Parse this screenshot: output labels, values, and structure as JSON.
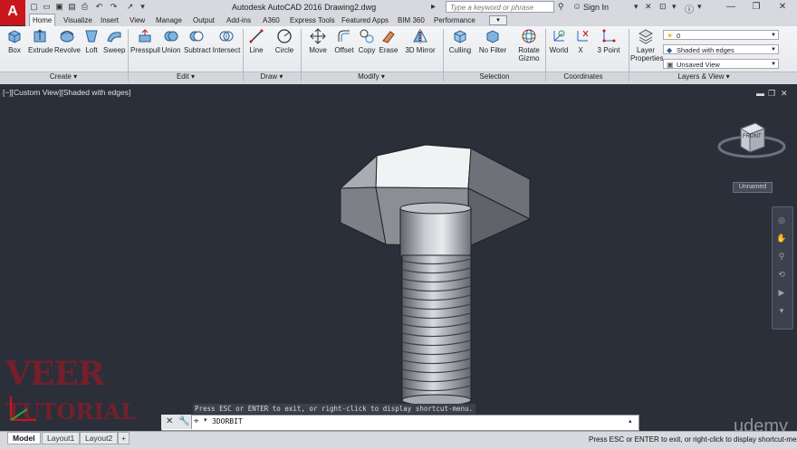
{
  "window": {
    "title": "Autodesk AutoCAD 2016   Drawing2.dwg",
    "search_placeholder": "Type a keyword or phrase",
    "signin_label": "Sign In",
    "app_logo": "A"
  },
  "tabs": [
    {
      "label": "Home",
      "active": true
    },
    {
      "label": "Visualize"
    },
    {
      "label": "Insert"
    },
    {
      "label": "View"
    },
    {
      "label": "Manage"
    },
    {
      "label": "Output"
    },
    {
      "label": "Add-ins"
    },
    {
      "label": "A360"
    },
    {
      "label": "Express Tools"
    },
    {
      "label": "Featured Apps"
    },
    {
      "label": "BIM 360"
    },
    {
      "label": "Performance"
    }
  ],
  "ribbon": {
    "create": {
      "label": "Create",
      "tools": [
        "Box",
        "Extrude",
        "Revolve",
        "Loft",
        "Sweep"
      ]
    },
    "edit": {
      "label": "Edit",
      "tools": [
        "Presspull",
        "Union",
        "Subtract",
        "Intersect"
      ]
    },
    "draw": {
      "label": "Draw",
      "tools": [
        "Line",
        "Circle"
      ]
    },
    "modify": {
      "label": "Modify",
      "tools": [
        "Move",
        "Offset",
        "Copy",
        "Erase",
        "3D Mirror"
      ]
    },
    "selection": {
      "label": "Selection",
      "tools": [
        "Culling",
        "No Filter",
        "Rotate Gizmo"
      ]
    },
    "coordinates": {
      "label": "Coordinates",
      "tools": [
        "World",
        "X",
        "3 Point"
      ]
    },
    "layers": {
      "label": "Layers & View",
      "tool": "Layer Properties",
      "layer_value": "0",
      "visual_style": "Shaded with edges",
      "view": "Unsaved View"
    }
  },
  "viewport": {
    "label": "[−][Custom View][Shaded with edges]",
    "viewcube_face": "FRONT",
    "ucs_name": "Unnamed"
  },
  "command": {
    "history": "Press ESC or ENTER to exit, or right-click to display shortcut-menu.",
    "input": "3DORBIT"
  },
  "layout_tabs": [
    "Model",
    "Layout1",
    "Layout2"
  ],
  "status_message": "Press ESC or ENTER to exit, or right-click to display shortcut-menu.",
  "watermark": {
    "line1": "VEER",
    "line2": "TUTORIAL"
  },
  "brand": "udemy",
  "colors": {
    "accent": "#c8161d",
    "background": "#2a2f3a"
  }
}
